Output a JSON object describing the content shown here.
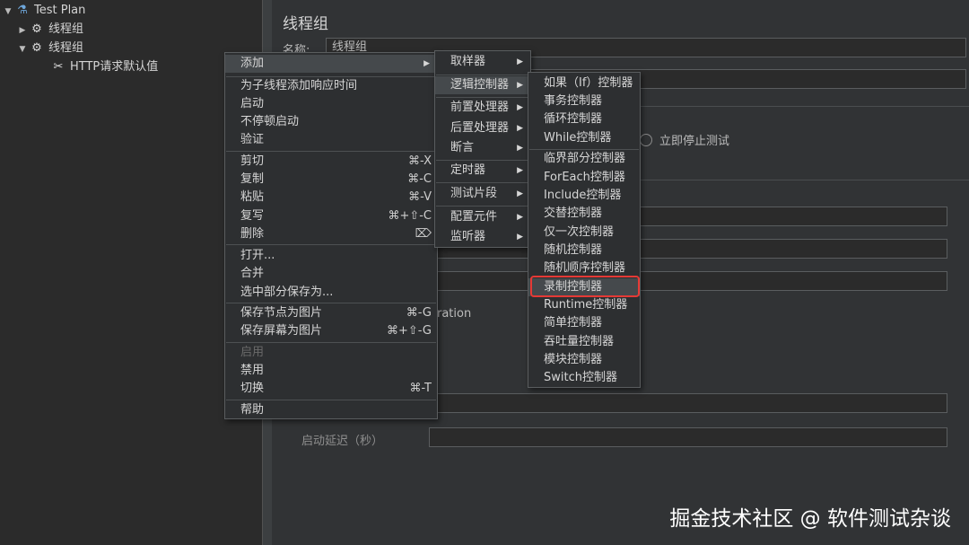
{
  "tree": {
    "items": [
      {
        "label": "Test Plan",
        "icon": "flask-icon"
      },
      {
        "label": "线程组",
        "icon": "gear-icon"
      },
      {
        "label": "线程组",
        "icon": "gear-icon"
      },
      {
        "label": "HTTP请求默认值",
        "icon": "wrench-icon"
      }
    ]
  },
  "panel": {
    "title": "线程组",
    "name_label": "名称:",
    "name_value": "线程组",
    "stop_now_label": "立即停止测试",
    "iteration_fragment": "ration",
    "delay_label": "启动延迟（秒）"
  },
  "context_menu": {
    "groups": [
      [
        {
          "label": "添加",
          "submenu": true
        }
      ],
      [
        {
          "label": "为子线程添加响应时间"
        },
        {
          "label": "启动"
        },
        {
          "label": "不停顿启动"
        },
        {
          "label": "验证"
        }
      ],
      [
        {
          "label": "剪切",
          "shortcut": "⌘-X"
        },
        {
          "label": "复制",
          "shortcut": "⌘-C"
        },
        {
          "label": "粘贴",
          "shortcut": "⌘-V"
        },
        {
          "label": "复写",
          "shortcut": "⌘+⇧-C"
        },
        {
          "label": "删除",
          "shortcut": "⌦"
        }
      ],
      [
        {
          "label": "打开..."
        },
        {
          "label": "合并"
        },
        {
          "label": "选中部分保存为..."
        }
      ],
      [
        {
          "label": "保存节点为图片",
          "shortcut": "⌘-G"
        },
        {
          "label": "保存屏幕为图片",
          "shortcut": "⌘+⇧-G"
        }
      ],
      [
        {
          "label": "启用",
          "disabled": true
        },
        {
          "label": "禁用"
        },
        {
          "label": "切换",
          "shortcut": "⌘-T"
        }
      ],
      [
        {
          "label": "帮助"
        }
      ]
    ]
  },
  "add_menu": {
    "groups": [
      [
        {
          "label": "取样器"
        }
      ],
      [
        {
          "label": "逻辑控制器"
        }
      ],
      [
        {
          "label": "前置处理器"
        },
        {
          "label": "后置处理器"
        },
        {
          "label": "断言"
        }
      ],
      [
        {
          "label": "定时器"
        }
      ],
      [
        {
          "label": "测试片段"
        }
      ],
      [
        {
          "label": "配置元件"
        },
        {
          "label": "监听器"
        }
      ]
    ]
  },
  "logic_menu": {
    "groups": [
      [
        "如果（If）控制器",
        "事务控制器",
        "循环控制器",
        "While控制器"
      ],
      [
        "临界部分控制器",
        "ForEach控制器",
        "Include控制器",
        "交替控制器",
        "仅一次控制器",
        "随机控制器",
        "随机顺序控制器",
        "录制控制器",
        "Runtime控制器",
        "简单控制器",
        "吞吐量控制器",
        "模块控制器",
        "Switch控制器"
      ]
    ],
    "highlighted": "录制控制器"
  },
  "watermark": "掘金技术社区 @ 软件测试杂谈",
  "colors": {
    "highlight": "#e53935",
    "menu_bg": "#2d2f31",
    "selected_bg": "#45494c"
  }
}
